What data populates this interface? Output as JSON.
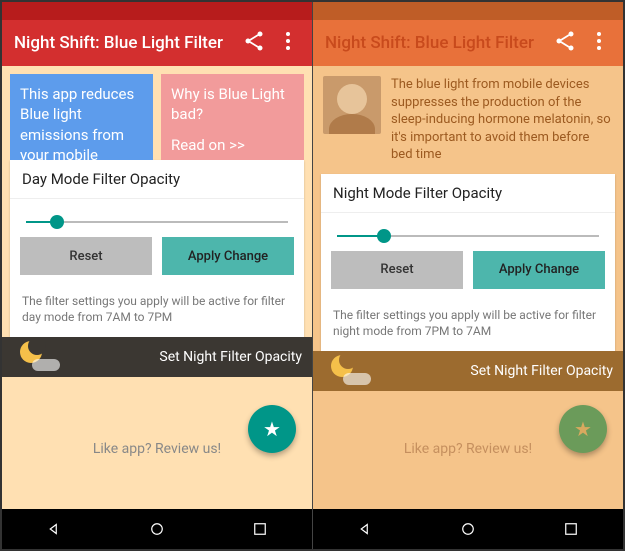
{
  "left": {
    "statusbar": {
      "time": " "
    },
    "appbar": {
      "title": "Night Shift: Blue Light Filter"
    },
    "cards": {
      "c1": "This app reduces Blue light emissions from your mobile",
      "c2": "Why is Blue Light bad?",
      "c2_read": "Read on >>"
    },
    "panel": {
      "heading": "Day Mode Filter Opacity",
      "slider_pct": 12,
      "reset_label": "Reset",
      "apply_label": "Apply Change",
      "hint": "The filter settings you apply will be active for filter day mode from 7AM to 7PM"
    },
    "nightbar": {
      "label": "Set Night Filter Opacity"
    },
    "footer": {
      "like": "Like app? Review us!"
    }
  },
  "right": {
    "statusbar": {
      "time": " "
    },
    "appbar": {
      "title": "Night Shift: Blue Light Filter"
    },
    "testimonial": {
      "text": "The blue light from mobile devices suppresses the production of the sleep-inducing hormone melatonin, so it's important to avoid them before bed time"
    },
    "panel": {
      "heading": "Night Mode Filter Opacity",
      "slider_pct": 18,
      "reset_label": "Reset",
      "apply_label": "Apply Change",
      "hint": "The filter settings you apply will be active for filter night mode from 7PM to 7AM"
    },
    "nightbar": {
      "label": "Set Night Filter Opacity"
    },
    "footer": {
      "like": "Like app? Review us!"
    }
  }
}
